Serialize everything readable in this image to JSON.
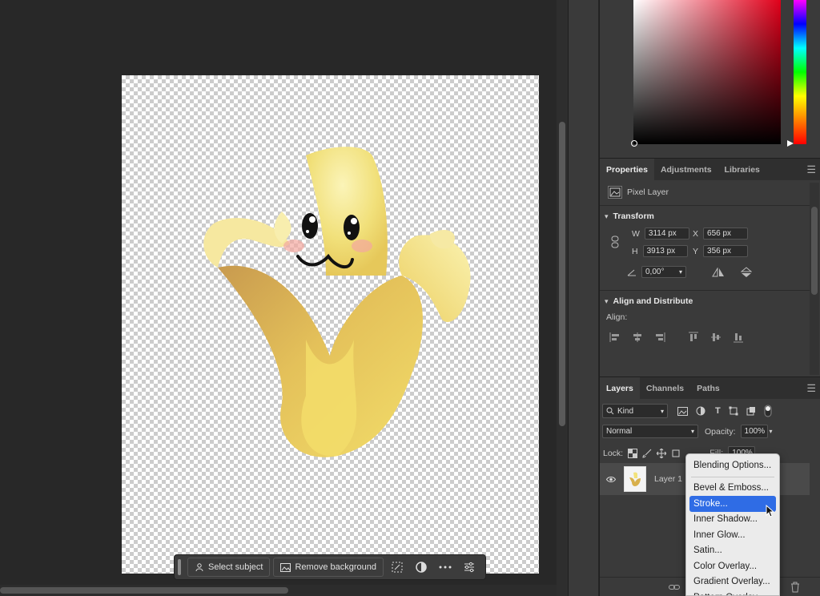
{
  "context_toolbar": {
    "select_subject": "Select subject",
    "remove_background": "Remove background"
  },
  "properties": {
    "tabs": [
      "Properties",
      "Adjustments",
      "Libraries"
    ],
    "layer_type": "Pixel Layer",
    "transform": {
      "title": "Transform",
      "w_label": "W",
      "w": "3114 px",
      "h_label": "H",
      "h": "3913 px",
      "x_label": "X",
      "x": "656 px",
      "y_label": "Y",
      "y": "356 px",
      "angle": "0,00°"
    },
    "align": {
      "title": "Align and Distribute",
      "label": "Align:"
    }
  },
  "layers": {
    "tabs": [
      "Layers",
      "Channels",
      "Paths"
    ],
    "kind": "Kind",
    "blend_mode": "Normal",
    "opacity_label": "Opacity:",
    "opacity": "100%",
    "lock_label": "Lock:",
    "fill_label": "Fill:",
    "fill": "100%",
    "layer_name": "Layer 1"
  },
  "context_menu": {
    "items": [
      "Blending Options...",
      "Bevel & Emboss...",
      "Stroke...",
      "Inner Shadow...",
      "Inner Glow...",
      "Satin...",
      "Color Overlay...",
      "Gradient Overlay...",
      "Pattern Overlay..."
    ],
    "highlighted": "Stroke..."
  },
  "colors": {
    "accent": "#2f6ce5",
    "panel_bg": "#3a3a3a",
    "canvas_bg": "#282828"
  }
}
